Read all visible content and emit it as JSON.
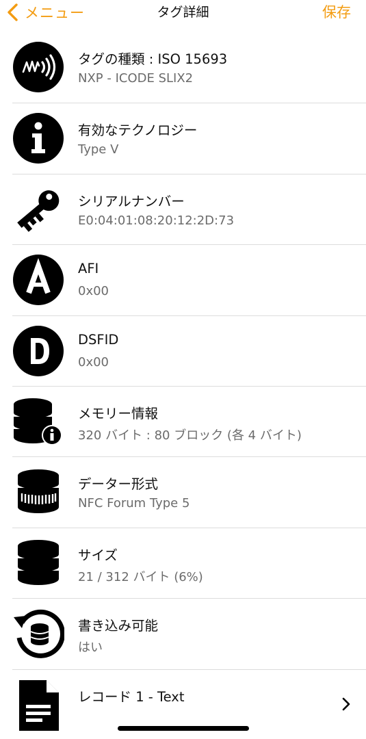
{
  "nav": {
    "back_label": "メニュー",
    "title": "タグ詳細",
    "save_label": "保存",
    "accent_color": "#f39c12"
  },
  "rows": [
    {
      "icon": "nfc-wave-icon",
      "title": "タグの種類 : ISO 15693",
      "sub": "NXP - ICODE SLIX2"
    },
    {
      "icon": "info-icon",
      "title": "有効なテクノロジー",
      "sub": "Type V"
    },
    {
      "icon": "key-icon",
      "title": "シリアルナンバー",
      "sub": "E0:04:01:08:20:12:2D:73"
    },
    {
      "icon": "letter-a-icon",
      "title": "AFI",
      "sub": "0x00"
    },
    {
      "icon": "letter-d-icon",
      "title": "DSFID",
      "sub": "0x00"
    },
    {
      "icon": "database-info-icon",
      "title": "メモリー情報",
      "sub": "320 バイト : 80 ブロック (各 4 バイト)"
    },
    {
      "icon": "database-format-icon",
      "title": "データー形式",
      "sub": "NFC Forum Type 5"
    },
    {
      "icon": "database-icon",
      "title": "サイズ",
      "sub": "21 / 312 バイト (6%)"
    },
    {
      "icon": "database-refresh-icon",
      "title": "書き込み可能",
      "sub": "はい"
    },
    {
      "icon": "document-icon",
      "title": "レコード 1 - Text",
      "sub": ""
    }
  ]
}
